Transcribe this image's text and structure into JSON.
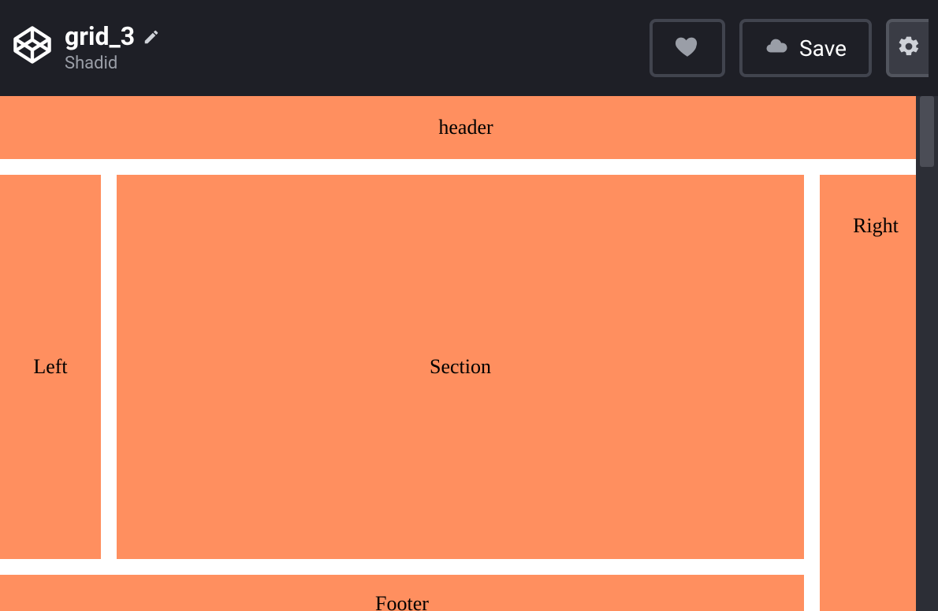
{
  "header": {
    "pen_title": "grid_3",
    "author": "Shadid",
    "save_label": "Save"
  },
  "preview": {
    "header_label": "header",
    "left_label": "Left",
    "section_label": "Section",
    "right_label": "Right",
    "footer_label": "Footer"
  },
  "colors": {
    "cell_bg": "#ff8f5f",
    "topbar_bg": "#1e1f26"
  }
}
